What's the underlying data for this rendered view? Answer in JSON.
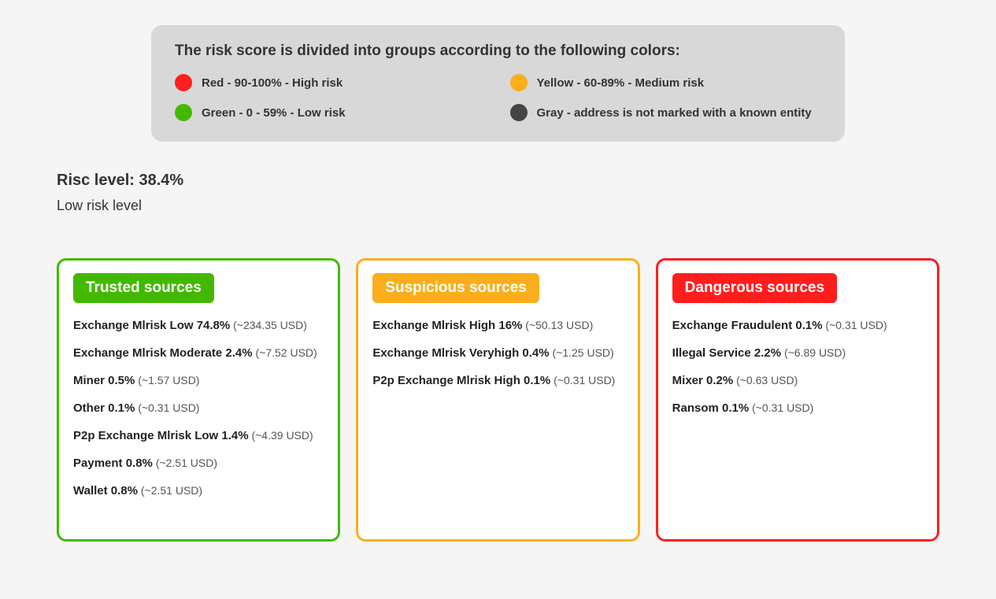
{
  "legend": {
    "title": "The risk score is divided into groups according to the following colors:",
    "items": [
      {
        "color": "red",
        "text": "Red - 90-100% - High risk"
      },
      {
        "color": "yellow",
        "text": "Yellow - 60-89% - Medium risk"
      },
      {
        "color": "green",
        "text": "Green - 0 - 59% - Low risk"
      },
      {
        "color": "gray",
        "text": "Gray - address is not marked with a known entity"
      }
    ]
  },
  "risk": {
    "level_line": "Risc level: 38.4%",
    "sub_line": "Low risk level"
  },
  "cards": {
    "trusted": {
      "title": "Trusted sources",
      "items": [
        {
          "name": "Exchange Mlrisk Low 74.8%",
          "usd": "(~234.35 USD)"
        },
        {
          "name": "Exchange Mlrisk Moderate 2.4%",
          "usd": "(~7.52 USD)"
        },
        {
          "name": "Miner 0.5%",
          "usd": "(~1.57 USD)"
        },
        {
          "name": "Other 0.1%",
          "usd": "(~0.31 USD)"
        },
        {
          "name": "P2p Exchange Mlrisk Low 1.4%",
          "usd": "(~4.39 USD)"
        },
        {
          "name": "Payment 0.8%",
          "usd": "(~2.51 USD)"
        },
        {
          "name": "Wallet 0.8%",
          "usd": "(~2.51 USD)"
        }
      ]
    },
    "suspicious": {
      "title": "Suspicious sources",
      "items": [
        {
          "name": "Exchange Mlrisk High 16%",
          "usd": "(~50.13 USD)"
        },
        {
          "name": "Exchange Mlrisk Veryhigh 0.4%",
          "usd": "(~1.25 USD)"
        },
        {
          "name": "P2p Exchange Mlrisk High 0.1%",
          "usd": "(~0.31 USD)"
        }
      ]
    },
    "dangerous": {
      "title": "Dangerous sources",
      "items": [
        {
          "name": "Exchange Fraudulent 0.1%",
          "usd": "(~0.31 USD)"
        },
        {
          "name": "Illegal Service 2.2%",
          "usd": "(~6.89 USD)"
        },
        {
          "name": "Mixer 0.2%",
          "usd": "(~0.63 USD)"
        },
        {
          "name": "Ransom 0.1%",
          "usd": "(~0.31 USD)"
        }
      ]
    }
  }
}
